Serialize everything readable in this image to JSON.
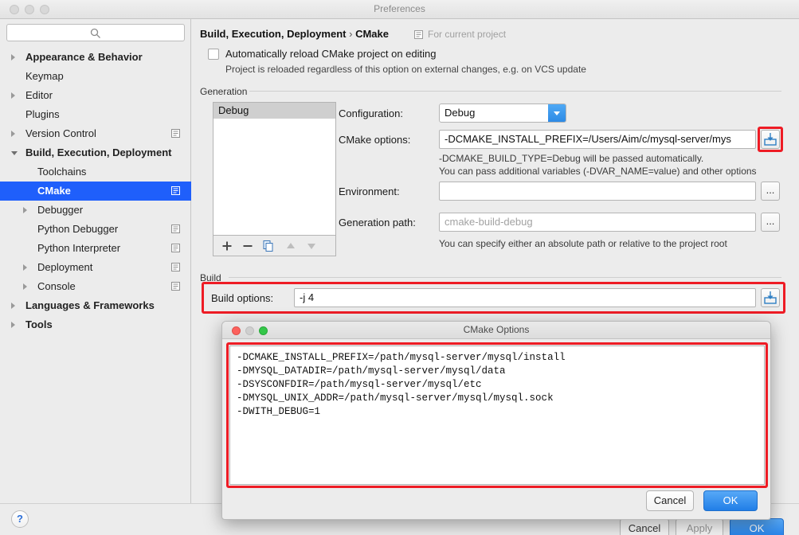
{
  "window": {
    "title": "Preferences",
    "traffic_lights": [
      "close-disabled",
      "minimize-disabled",
      "zoom-disabled"
    ]
  },
  "search": {
    "value": "",
    "placeholder": "",
    "icon": "search-icon"
  },
  "sidebar": {
    "items": [
      {
        "label": "Appearance & Behavior",
        "arrow": "closed",
        "indent": 32,
        "bold": true,
        "selected": false,
        "project_icon": false
      },
      {
        "label": "Keymap",
        "arrow": "none",
        "indent": 32,
        "bold": false,
        "selected": false,
        "project_icon": false
      },
      {
        "label": "Editor",
        "arrow": "closed",
        "indent": 32,
        "bold": false,
        "selected": false,
        "project_icon": false
      },
      {
        "label": "Plugins",
        "arrow": "none",
        "indent": 32,
        "bold": false,
        "selected": false,
        "project_icon": false
      },
      {
        "label": "Version Control",
        "arrow": "closed",
        "indent": 32,
        "bold": false,
        "selected": false,
        "project_icon": true
      },
      {
        "label": "Build, Execution, Deployment",
        "arrow": "open",
        "indent": 32,
        "bold": true,
        "selected": false,
        "project_icon": false
      },
      {
        "label": "Toolchains",
        "arrow": "none",
        "indent": 47,
        "bold": false,
        "selected": false,
        "project_icon": false
      },
      {
        "label": "CMake",
        "arrow": "none",
        "indent": 47,
        "bold": true,
        "selected": true,
        "project_icon": true
      },
      {
        "label": "Debugger",
        "arrow": "closed",
        "indent": 47,
        "bold": false,
        "selected": false,
        "project_icon": false
      },
      {
        "label": "Python Debugger",
        "arrow": "none",
        "indent": 47,
        "bold": false,
        "selected": false,
        "project_icon": true
      },
      {
        "label": "Python Interpreter",
        "arrow": "none",
        "indent": 47,
        "bold": false,
        "selected": false,
        "project_icon": true
      },
      {
        "label": "Deployment",
        "arrow": "closed",
        "indent": 47,
        "bold": false,
        "selected": false,
        "project_icon": true
      },
      {
        "label": "Console",
        "arrow": "closed",
        "indent": 47,
        "bold": false,
        "selected": false,
        "project_icon": true
      },
      {
        "label": "Languages & Frameworks",
        "arrow": "closed",
        "indent": 32,
        "bold": true,
        "selected": false,
        "project_icon": false
      },
      {
        "label": "Tools",
        "arrow": "closed",
        "indent": 32,
        "bold": true,
        "selected": false,
        "project_icon": false
      }
    ]
  },
  "main": {
    "breadcrumb_path": "Build, Execution, Deployment",
    "breadcrumb_sep": "›",
    "breadcrumb_current": "CMake",
    "scope_note": "For current project",
    "auto_reload": {
      "label": "Automatically reload CMake project on editing",
      "sub": "Project is reloaded regardless of this option on external changes, e.g. on VCS update",
      "checked": false
    },
    "generation": {
      "section_label": "Generation",
      "profiles": [
        "Debug"
      ],
      "toolbar": [
        "add-icon",
        "remove-icon",
        "copy-icon",
        "move-up-icon",
        "move-down-icon"
      ],
      "configuration_label": "Configuration:",
      "configuration_value": "Debug",
      "cmake_options_label": "CMake options:",
      "cmake_options_value": "-DCMAKE_INSTALL_PREFIX=/Users/Aim/c/mysql-server/mys",
      "cmake_options_hint1": "-DCMAKE_BUILD_TYPE=Debug will be passed automatically.",
      "cmake_options_hint2": "You can pass additional variables (-DVAR_NAME=value) and other options",
      "environment_label": "Environment:",
      "environment_value": "",
      "generation_path_label": "Generation path:",
      "generation_path_placeholder": "cmake-build-debug",
      "generation_path_hint": "You can specify either an absolute path or relative to the project root",
      "dots_label": "..."
    },
    "build": {
      "section_label": "Build",
      "build_options_label": "Build options:",
      "build_options_value": "-j 4"
    }
  },
  "dialog": {
    "title": "CMake Options",
    "text": "-DCMAKE_INSTALL_PREFIX=/path/mysql-server/mysql/install\n-DMYSQL_DATADIR=/path/mysql-server/mysql/data\n-DSYSCONFDIR=/path/mysql-server/mysql/etc\n-DMYSQL_UNIX_ADDR=/path/mysql-server/mysql/mysql.sock\n-DWITH_DEBUG=1",
    "cancel_label": "Cancel",
    "ok_label": "OK"
  },
  "bottom": {
    "help_label": "?",
    "cancel_label": "Cancel",
    "apply_label": "Apply",
    "ok_label": "OK"
  },
  "colors": {
    "selection_blue": "#1f5ffb",
    "highlight_red": "#ee1c25",
    "primary_button_blue": "#217ee7",
    "traffic_close": "#fc615d",
    "traffic_zoom": "#34c749"
  }
}
